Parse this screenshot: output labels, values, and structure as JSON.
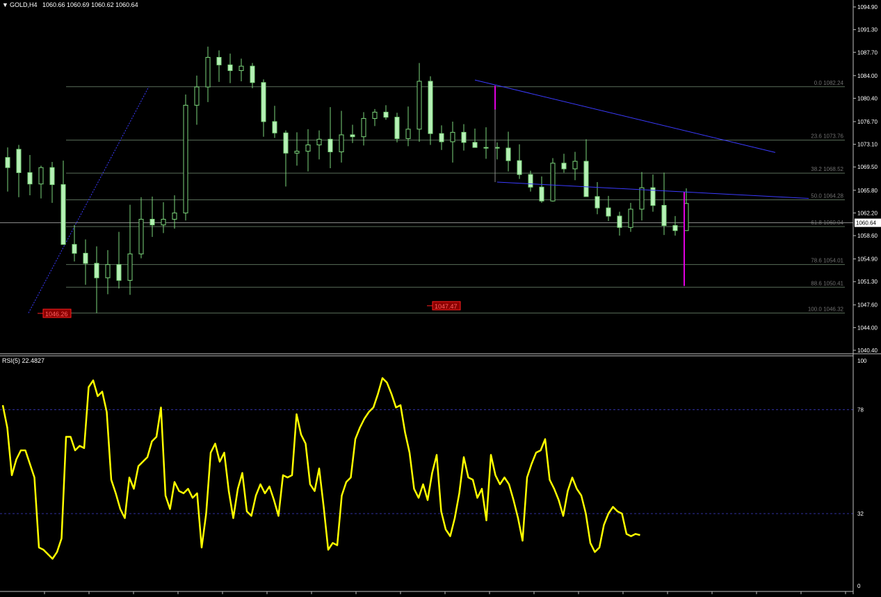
{
  "header": {
    "caret": "▼",
    "symbol": "GOLD,H4",
    "ohlc": "1060.66 1060.69 1060.62 1060.64"
  },
  "rsi_header": "RSI(5) 22.4827",
  "colors": {
    "background": "#000000",
    "grid_frame": "#c0c0c0",
    "candle_up": "#000000",
    "candle_down": "#b6f0b6",
    "wick": "#7cd67c",
    "fib_line": "#5a6e5a",
    "trend_line": "#3b3bff",
    "marker": "#e000e0",
    "price_label_bg": "#8b0000",
    "price_label_border": "#ff2020",
    "rsi_line": "#ffff00",
    "rsi_level": "#3030a0"
  },
  "chart_data": [
    {
      "type": "candlestick",
      "symbol": "GOLD",
      "timeframe": "H4",
      "ylim": [
        1040.4,
        1094.9
      ],
      "y_ticks": [
        "1094.90",
        "1091.30",
        "1087.70",
        "1084.00",
        "1080.40",
        "1076.70",
        "1073.10",
        "1069.50",
        "1065.80",
        "1062.20",
        "1058.60",
        "1054.90",
        "1051.30",
        "1047.60",
        "1044.00",
        "1040.40"
      ],
      "current_price": "1060.64",
      "fibonacci": {
        "levels": [
          {
            "label": "0.0 1082.24",
            "price": 1082.24
          },
          {
            "label": "23.6 1073.76",
            "price": 1073.76
          },
          {
            "label": "38.2 1068.52",
            "price": 1068.52
          },
          {
            "label": "50.0 1064.28",
            "price": 1064.28
          },
          {
            "label": "61.8 1060.04",
            "price": 1060.04
          },
          {
            "label": "78.6 1054.01",
            "price": 1054.01
          },
          {
            "label": "88.6 1050.41",
            "price": 1050.41
          },
          {
            "label": "100.0 1046.32",
            "price": 1046.32
          }
        ]
      },
      "price_labels": [
        {
          "text": "1046.26",
          "price": 1046.26,
          "bar": 3
        },
        {
          "text": "1047.47",
          "price": 1047.47,
          "bar": 38
        }
      ],
      "trendlines": [
        {
          "from": {
            "bar": 42,
            "price": 1083.3
          },
          "to": {
            "bar": 69,
            "price": 1071.8
          }
        },
        {
          "from": {
            "bar": 44,
            "price": 1067.1
          },
          "to": {
            "bar": 72,
            "price": 1064.5
          }
        }
      ],
      "vertical_markers": [
        {
          "bar": 44,
          "from": 1082.4,
          "to": 1078.6,
          "dashed_down_to": 1067.1
        },
        {
          "bar": 61,
          "from": 1065.5,
          "to": 1050.6
        }
      ],
      "fib_anchor": {
        "from": {
          "bar": 2,
          "price": 1046.32
        },
        "to": {
          "bar": 13,
          "price": 1082.24
        }
      },
      "candles": [
        {
          "o": 1071.0,
          "h": 1072.6,
          "l": 1065.6,
          "c": 1069.4
        },
        {
          "o": 1072.3,
          "h": 1073.0,
          "l": 1064.7,
          "c": 1068.6
        },
        {
          "o": 1068.6,
          "h": 1071.4,
          "l": 1065.0,
          "c": 1066.8
        },
        {
          "o": 1066.8,
          "h": 1069.7,
          "l": 1064.5,
          "c": 1069.4
        },
        {
          "o": 1069.4,
          "h": 1070.3,
          "l": 1063.8,
          "c": 1066.7
        },
        {
          "o": 1066.7,
          "h": 1070.5,
          "l": 1062.8,
          "c": 1057.2
        },
        {
          "o": 1057.2,
          "h": 1060.3,
          "l": 1054.5,
          "c": 1055.8
        },
        {
          "o": 1055.8,
          "h": 1058.0,
          "l": 1050.8,
          "c": 1054.2
        },
        {
          "o": 1054.2,
          "h": 1056.9,
          "l": 1046.3,
          "c": 1051.9
        },
        {
          "o": 1051.9,
          "h": 1056.3,
          "l": 1049.3,
          "c": 1054.0
        },
        {
          "o": 1054.0,
          "h": 1059.2,
          "l": 1050.2,
          "c": 1051.5
        },
        {
          "o": 1051.5,
          "h": 1063.5,
          "l": 1049.2,
          "c": 1055.7
        },
        {
          "o": 1055.7,
          "h": 1064.7,
          "l": 1055.0,
          "c": 1061.2
        },
        {
          "o": 1061.2,
          "h": 1064.8,
          "l": 1058.4,
          "c": 1060.3
        },
        {
          "o": 1060.3,
          "h": 1063.9,
          "l": 1059.0,
          "c": 1061.2
        },
        {
          "o": 1061.2,
          "h": 1065.0,
          "l": 1059.7,
          "c": 1062.2
        },
        {
          "o": 1062.2,
          "h": 1081.0,
          "l": 1061.0,
          "c": 1079.3
        },
        {
          "o": 1079.3,
          "h": 1084.0,
          "l": 1076.2,
          "c": 1082.2
        },
        {
          "o": 1082.2,
          "h": 1088.6,
          "l": 1079.8,
          "c": 1086.9
        },
        {
          "o": 1086.9,
          "h": 1088.0,
          "l": 1083.0,
          "c": 1085.7
        },
        {
          "o": 1085.7,
          "h": 1087.5,
          "l": 1082.8,
          "c": 1084.8
        },
        {
          "o": 1084.8,
          "h": 1086.7,
          "l": 1083.1,
          "c": 1085.5
        },
        {
          "o": 1085.5,
          "h": 1086.0,
          "l": 1082.0,
          "c": 1082.9
        },
        {
          "o": 1082.9,
          "h": 1083.4,
          "l": 1074.3,
          "c": 1076.7
        },
        {
          "o": 1076.7,
          "h": 1079.2,
          "l": 1074.1,
          "c": 1074.9
        },
        {
          "o": 1074.9,
          "h": 1075.3,
          "l": 1066.4,
          "c": 1071.7
        },
        {
          "o": 1071.7,
          "h": 1075.0,
          "l": 1069.7,
          "c": 1072.0
        },
        {
          "o": 1072.0,
          "h": 1075.5,
          "l": 1068.8,
          "c": 1073.0
        },
        {
          "o": 1073.0,
          "h": 1075.3,
          "l": 1070.7,
          "c": 1073.9
        },
        {
          "o": 1073.9,
          "h": 1079.0,
          "l": 1069.3,
          "c": 1071.9
        },
        {
          "o": 1071.9,
          "h": 1078.4,
          "l": 1070.2,
          "c": 1074.6
        },
        {
          "o": 1074.6,
          "h": 1076.2,
          "l": 1073.3,
          "c": 1074.3
        },
        {
          "o": 1074.3,
          "h": 1078.2,
          "l": 1072.9,
          "c": 1077.2
        },
        {
          "o": 1077.2,
          "h": 1078.7,
          "l": 1076.0,
          "c": 1078.2
        },
        {
          "o": 1078.2,
          "h": 1079.3,
          "l": 1077.0,
          "c": 1077.4
        },
        {
          "o": 1077.4,
          "h": 1078.1,
          "l": 1073.4,
          "c": 1074.0
        },
        {
          "o": 1074.0,
          "h": 1079.1,
          "l": 1072.8,
          "c": 1075.5
        },
        {
          "o": 1075.5,
          "h": 1086.0,
          "l": 1073.5,
          "c": 1083.1
        },
        {
          "o": 1083.1,
          "h": 1083.9,
          "l": 1073.0,
          "c": 1074.8
        },
        {
          "o": 1074.8,
          "h": 1076.1,
          "l": 1072.2,
          "c": 1073.5
        },
        {
          "o": 1073.5,
          "h": 1076.7,
          "l": 1070.2,
          "c": 1075.0
        },
        {
          "o": 1075.0,
          "h": 1076.3,
          "l": 1072.1,
          "c": 1073.4
        },
        {
          "o": 1073.4,
          "h": 1075.6,
          "l": 1072.9,
          "c": 1072.6
        },
        {
          "o": 1072.6,
          "h": 1075.8,
          "l": 1070.8,
          "c": 1072.6
        },
        {
          "o": 1072.6,
          "h": 1073.4,
          "l": 1070.7,
          "c": 1072.5
        },
        {
          "o": 1072.5,
          "h": 1075.1,
          "l": 1068.8,
          "c": 1070.5
        },
        {
          "o": 1070.5,
          "h": 1073.1,
          "l": 1067.6,
          "c": 1068.3
        },
        {
          "o": 1068.3,
          "h": 1068.9,
          "l": 1065.6,
          "c": 1066.3
        },
        {
          "o": 1066.3,
          "h": 1068.0,
          "l": 1063.8,
          "c": 1064.1
        },
        {
          "o": 1064.1,
          "h": 1070.9,
          "l": 1064.0,
          "c": 1070.1
        },
        {
          "o": 1070.1,
          "h": 1071.6,
          "l": 1068.6,
          "c": 1069.2
        },
        {
          "o": 1069.2,
          "h": 1071.9,
          "l": 1067.4,
          "c": 1070.4
        },
        {
          "o": 1070.4,
          "h": 1073.9,
          "l": 1065.5,
          "c": 1064.8
        },
        {
          "o": 1064.8,
          "h": 1067.1,
          "l": 1062.0,
          "c": 1063.0
        },
        {
          "o": 1063.0,
          "h": 1064.9,
          "l": 1060.9,
          "c": 1061.7
        },
        {
          "o": 1061.7,
          "h": 1062.4,
          "l": 1058.6,
          "c": 1059.9
        },
        {
          "o": 1059.9,
          "h": 1063.8,
          "l": 1059.2,
          "c": 1062.8
        },
        {
          "o": 1062.8,
          "h": 1068.7,
          "l": 1061.0,
          "c": 1066.2
        },
        {
          "o": 1066.2,
          "h": 1068.3,
          "l": 1062.4,
          "c": 1063.4
        },
        {
          "o": 1063.4,
          "h": 1068.6,
          "l": 1058.7,
          "c": 1060.2
        },
        {
          "o": 1060.2,
          "h": 1061.7,
          "l": 1058.6,
          "c": 1059.4
        },
        {
          "o": 1059.4,
          "h": 1066.1,
          "l": 1059.8,
          "c": 1063.7
        }
      ]
    },
    {
      "type": "line",
      "name": "RSI(5)",
      "current_value": "22.4827",
      "ylim": [
        0,
        100
      ],
      "y_ticks": [
        "100",
        "78",
        "32",
        "0"
      ],
      "levels": [
        78,
        32
      ],
      "values": [
        80,
        70,
        49,
        56,
        60,
        60,
        54,
        48,
        17,
        16,
        14,
        12,
        15,
        21,
        66,
        66,
        60,
        62,
        61,
        88,
        91,
        84,
        86,
        77,
        47,
        41,
        34,
        30,
        48,
        43,
        53,
        55,
        57,
        64,
        66,
        79,
        40,
        34,
        46,
        42,
        41,
        43,
        39,
        41,
        17,
        32,
        59,
        63,
        55,
        59,
        42,
        30,
        43,
        50,
        33,
        31,
        40,
        45,
        41,
        44,
        38,
        31,
        49,
        48,
        49,
        76,
        67,
        63,
        45,
        42,
        52,
        35,
        16,
        19,
        18,
        40,
        46,
        48,
        65,
        70,
        74,
        77,
        79,
        85,
        92,
        90,
        85,
        79,
        80,
        68,
        59,
        43,
        39,
        45,
        38,
        50,
        58,
        33,
        25,
        22,
        30,
        41,
        57,
        48,
        47,
        39,
        43,
        29,
        58,
        49,
        45,
        48,
        45,
        38,
        30,
        20,
        48,
        54,
        59,
        60,
        65,
        47,
        43,
        38,
        31,
        42,
        48,
        43,
        40,
        32,
        19,
        15,
        17,
        27,
        32,
        35,
        33,
        32,
        23,
        22,
        23,
        22.4827
      ]
    }
  ]
}
